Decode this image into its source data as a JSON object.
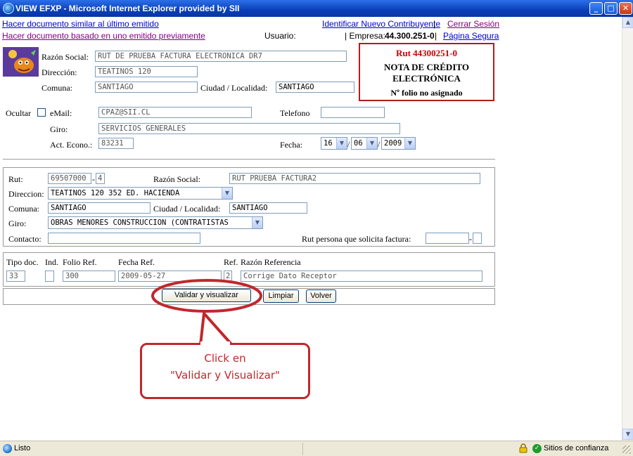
{
  "window": {
    "title": "VIEW EFXP - Microsoft Internet Explorer provided by SII",
    "buttons": {
      "minimize": "_",
      "maximize": "□",
      "close": "✕"
    }
  },
  "topbar": {
    "link_similar": "Hacer documento similar al último emitido",
    "link_based": "Hacer documento basado en uno emitido previamente",
    "link_identify": "Identificar Nuevo Contribuyente",
    "link_logout": "Cerrar Sesión",
    "sep": "|",
    "usuario_label": "Usuario:",
    "empresa_label": "| Empresa:",
    "empresa_value": "44.300.251-0",
    "link_secure": "Página Segura"
  },
  "issuer": {
    "razon_social_label": "Razón Social:",
    "razon_social_value": "RUT DE PRUEBA FACTURA ELECTRONICA DR7",
    "direccion_label": "Dirección:",
    "direccion_value": "TEATINOS 120",
    "comuna_label": "Comuna:",
    "comuna_value": "SANTIAGO",
    "ciudad_label": "Ciudad / Localidad:",
    "ciudad_value": "SANTIAGO",
    "ocultar_label": "Ocultar",
    "email_label": "eMail:",
    "email_value": "CPAZ@SII.CL",
    "telefono_label": "Telefono",
    "telefono_value": "",
    "giro_label": "Giro:",
    "giro_value": "SERVICIOS GENERALES",
    "acteco_label": "Act. Econo.:",
    "acteco_value": "83231",
    "fecha_label": "Fecha:",
    "fecha_day": "16",
    "fecha_month": "06",
    "fecha_year": "2009",
    "slash": "/"
  },
  "docbox": {
    "rut": "Rut 44300251-0",
    "type_line1": "NOTA DE CRÉDITO",
    "type_line2": "ELECTRÓNICA",
    "folio": "Nº folio no asignado"
  },
  "receiver": {
    "rut_label": "Rut:",
    "rut_value": "69507000",
    "rut_dash": "-",
    "rut_dv": "4",
    "razon_label": "Razón Social:",
    "razon_value": "RUT PRUEBA FACTURA2",
    "direccion_label": "Direccion:",
    "direccion_value": "TEATINOS 120 352 ED. HACIENDA",
    "comuna_label": "Comuna:",
    "comuna_value": "SANTIAGO",
    "ciudad_label": "Ciudad / Localidad:",
    "ciudad_value": "SANTIAGO",
    "giro_label": "Giro:",
    "giro_value": "OBRAS MENORES CONSTRUCCION (CONTRATISTAS",
    "contacto_label": "Contacto:",
    "contacto_value": "",
    "solicita_label": "Rut persona que solicita factura:",
    "solicita_value": "",
    "solicita_dash": "-",
    "solicita_dv": ""
  },
  "reference": {
    "tipo_label": "Tipo doc.",
    "ind_label": "Ind.",
    "folio_label": "Folio Ref.",
    "fecha_label": "Fecha Ref.",
    "ref_label": "Ref.",
    "razon_label": "Razón Referencia",
    "tipo_value": "33",
    "ind_value": "",
    "folio_value": "300",
    "fecha_value": "2009-05-27",
    "ref_value": "2",
    "razon_value": "Corrige Dato Receptor"
  },
  "actions": {
    "validate": "Validar y visualizar",
    "clear": "Limpiar",
    "back": "Volver"
  },
  "callout": {
    "line1": "Click en",
    "line2": "\"Validar y Visualizar\""
  },
  "status": {
    "text": "Listo",
    "zone": "Sitios de confianza"
  },
  "colors": {
    "accent_red": "#c0282d",
    "link_blue": "#0000cc",
    "link_visited": "#800080",
    "title_blue": "#0a3fb8"
  }
}
